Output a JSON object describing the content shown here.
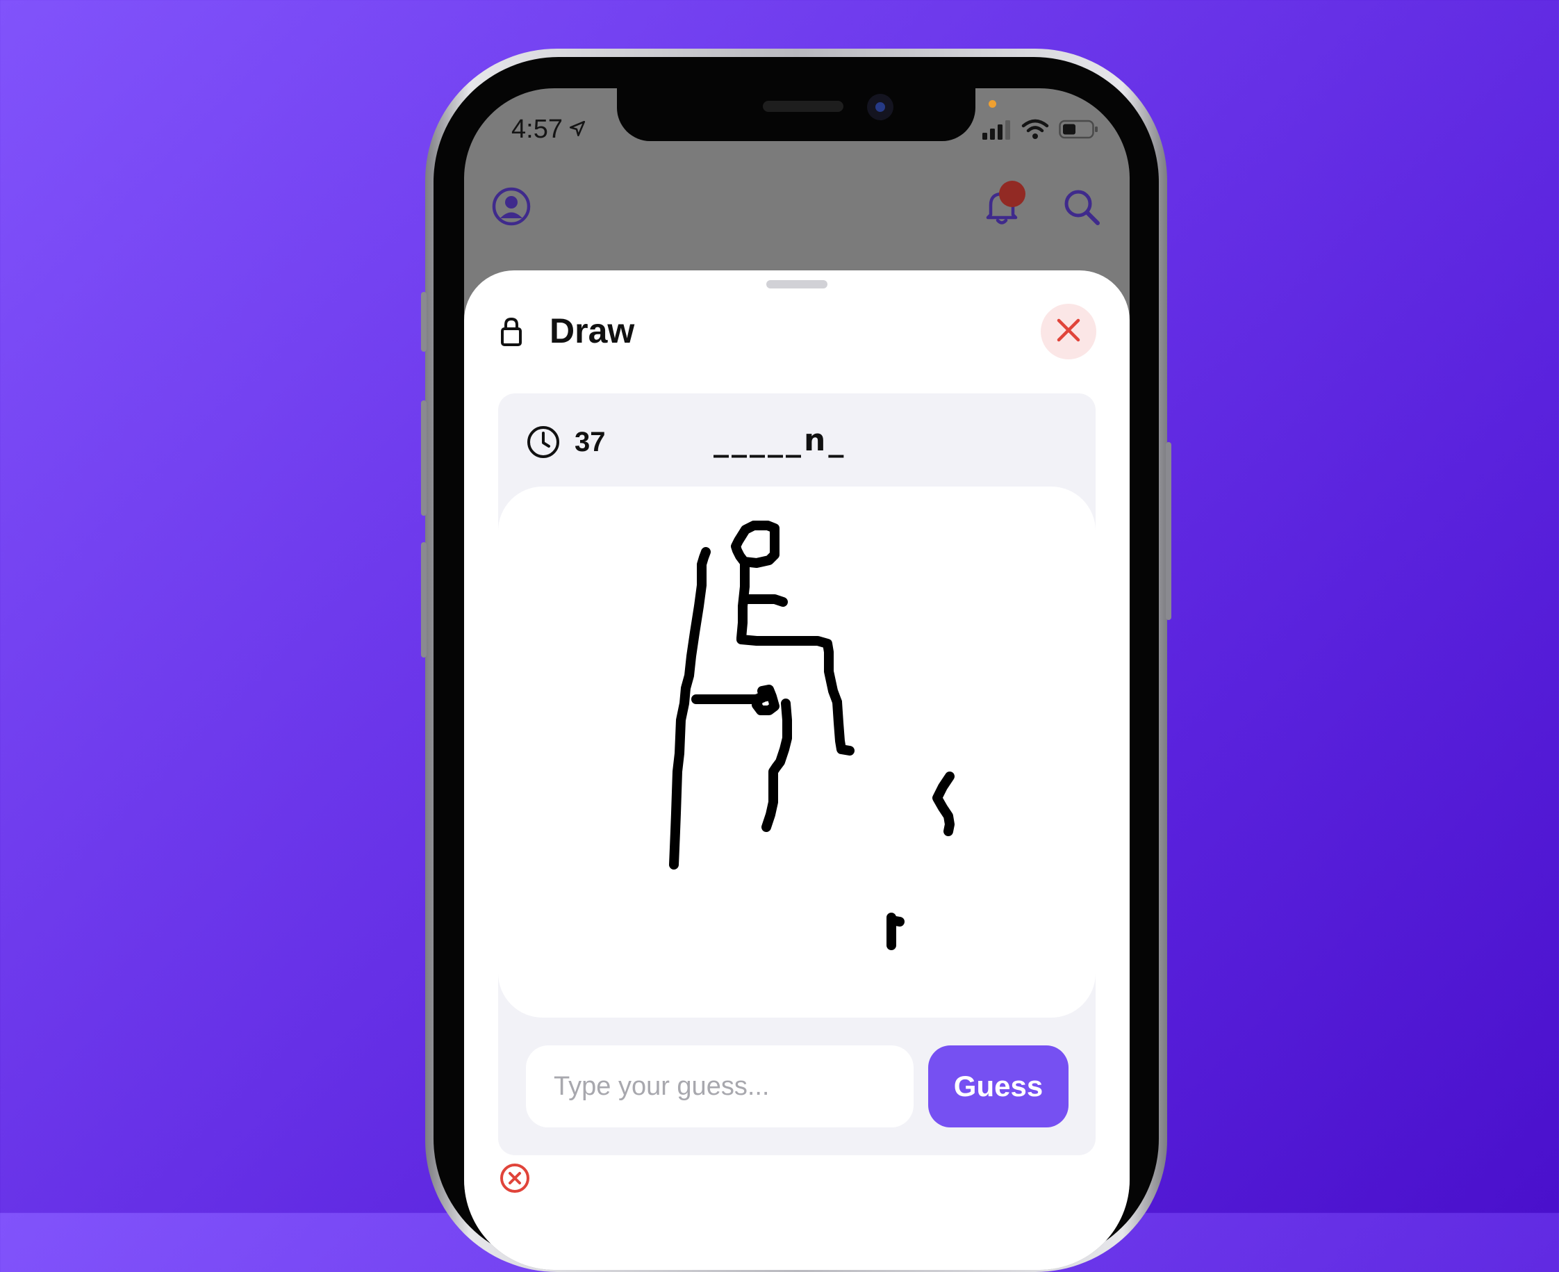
{
  "status_bar": {
    "time": "4:57"
  },
  "top_bar": {
    "icons": [
      "profile-icon",
      "bell-icon",
      "search-icon"
    ],
    "notification_badge_color": "#922a24"
  },
  "sheet": {
    "title": "Draw",
    "icons": [
      "lock-icon",
      "close-icon"
    ]
  },
  "game": {
    "timer": "37",
    "word_hint": "_____n_",
    "guess_placeholder": "Type your guess...",
    "guess_button_label": "Guess"
  },
  "colors": {
    "accent": "#7650f2",
    "icon_purple": "#3f2a8c",
    "close_red": "#e0443a",
    "close_bg": "#fbe6e6",
    "card_bg": "#f2f2f7"
  }
}
